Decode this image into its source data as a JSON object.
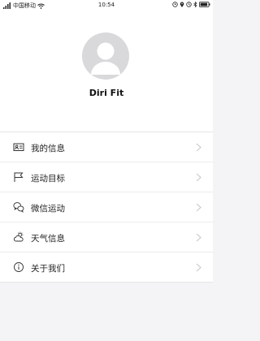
{
  "status_bar": {
    "carrier": "中国移动",
    "time": "10:54"
  },
  "profile": {
    "username": "Diri Fit"
  },
  "menu": {
    "items": [
      {
        "label": "我的信息",
        "icon": "id-card-icon"
      },
      {
        "label": "运动目标",
        "icon": "flag-icon"
      },
      {
        "label": "微信运动",
        "icon": "wechat-icon"
      },
      {
        "label": "天气信息",
        "icon": "weather-icon"
      },
      {
        "label": "关于我们",
        "icon": "info-icon"
      }
    ]
  },
  "colors": {
    "background": "#f4f4f6",
    "card": "#ffffff",
    "avatar_bg": "#d9d9dc",
    "chevron": "#c8c8cc"
  }
}
